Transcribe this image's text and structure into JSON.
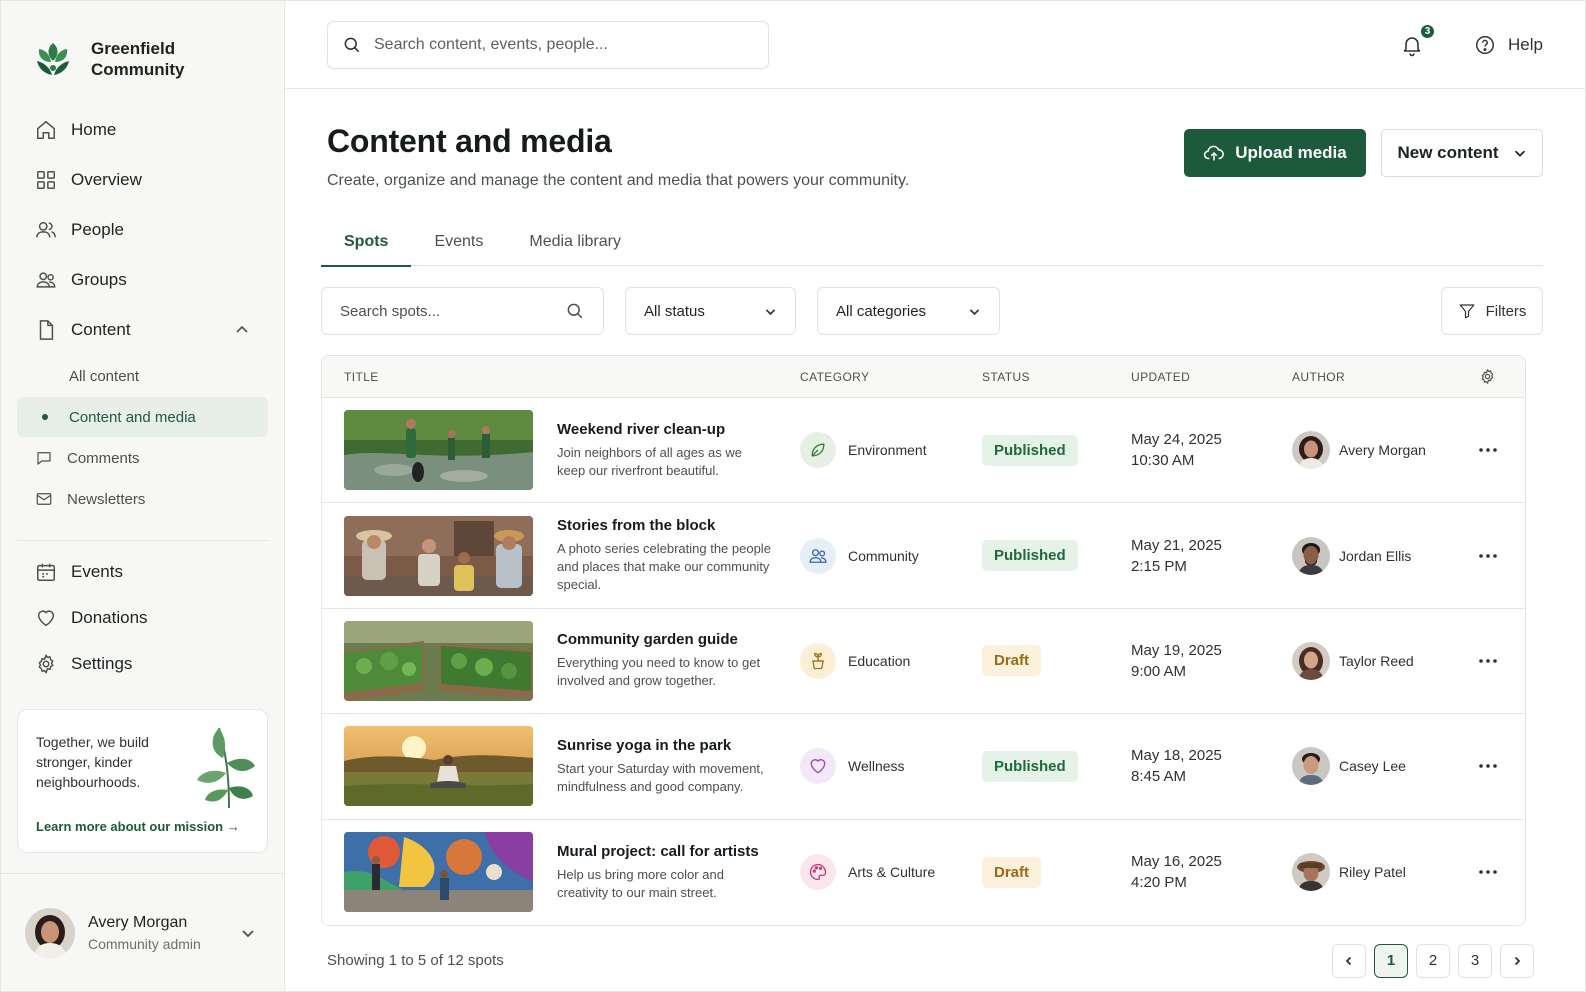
{
  "brand": {
    "name": "Greenfield Community"
  },
  "nav": {
    "items": [
      {
        "label": "Home",
        "icon": "home-icon"
      },
      {
        "label": "Overview",
        "icon": "grid-icon"
      },
      {
        "label": "People",
        "icon": "people-icon"
      },
      {
        "label": "Groups",
        "icon": "groups-icon"
      },
      {
        "label": "Content",
        "icon": "document-icon",
        "expanded": true
      }
    ],
    "content_sub": [
      {
        "label": "All content"
      },
      {
        "label": "Content and media",
        "active": true
      },
      {
        "label": "Comments",
        "icon": "comment-icon"
      },
      {
        "label": "Newsletters",
        "icon": "mail-icon"
      }
    ],
    "items2": [
      {
        "label": "Events",
        "icon": "calendar-icon"
      },
      {
        "label": "Donations",
        "icon": "heart-icon"
      },
      {
        "label": "Settings",
        "icon": "gear-icon"
      }
    ]
  },
  "mission": {
    "text": "Together, we build stronger, kinder neighbourhoods.",
    "link": "Learn more about our mission →"
  },
  "user": {
    "name": "Avery Morgan",
    "role": "Community admin"
  },
  "topbar": {
    "search_placeholder": "Search content, events, people...",
    "notifications_count": "3",
    "help_label": "Help"
  },
  "page": {
    "title": "Content and media",
    "subtitle": "Create, organize and manage the content and media that powers your community.",
    "upload_label": "Upload media",
    "new_label": "New content"
  },
  "tabs": [
    {
      "label": "Spots",
      "active": true
    },
    {
      "label": "Events"
    },
    {
      "label": "Media library"
    }
  ],
  "filters": {
    "search_placeholder": "Search spots...",
    "status_value": "All status",
    "category_value": "All categories",
    "filters_label": "Filters"
  },
  "table": {
    "headers": {
      "title": "TITLE",
      "category": "CATEGORY",
      "status": "STATUS",
      "updated": "UPDATED",
      "author": "AUTHOR"
    },
    "rows": [
      {
        "title": "Weekend river clean-up",
        "desc": "Join neighbors of all ages as we keep our riverfront beautiful.",
        "category": "Environment",
        "status": "Published",
        "date": "May 24, 2025",
        "time": "10:30 AM",
        "author": "Avery Morgan"
      },
      {
        "title": "Stories from the block",
        "desc": "A photo series celebrating the people and places that make our community special.",
        "category": "Community",
        "status": "Published",
        "date": "May 21, 2025",
        "time": "2:15 PM",
        "author": "Jordan Ellis"
      },
      {
        "title": "Community garden guide",
        "desc": "Everything you need to know to get involved and grow together.",
        "category": "Education",
        "status": "Draft",
        "date": "May 19, 2025",
        "time": "9:00 AM",
        "author": "Taylor Reed"
      },
      {
        "title": "Sunrise yoga in the park",
        "desc": "Start your Saturday with movement, mindfulness and good company.",
        "category": "Wellness",
        "status": "Published",
        "date": "May 18, 2025",
        "time": "8:45 AM",
        "author": "Casey Lee"
      },
      {
        "title": "Mural project: call for artists",
        "desc": "Help us bring more color and creativity to our main street.",
        "category": "Arts & Culture",
        "status": "Draft",
        "date": "May 16, 2025",
        "time": "4:20 PM",
        "author": "Riley Patel"
      }
    ]
  },
  "footer": {
    "showing": "Showing 1 to 5 of 12 spots",
    "pages": [
      "1",
      "2",
      "3"
    ],
    "current_page": "1"
  },
  "colors": {
    "brand": "#1d5a3a",
    "published_bg": "#e4f2e7",
    "draft_bg": "#fcf1dc"
  }
}
